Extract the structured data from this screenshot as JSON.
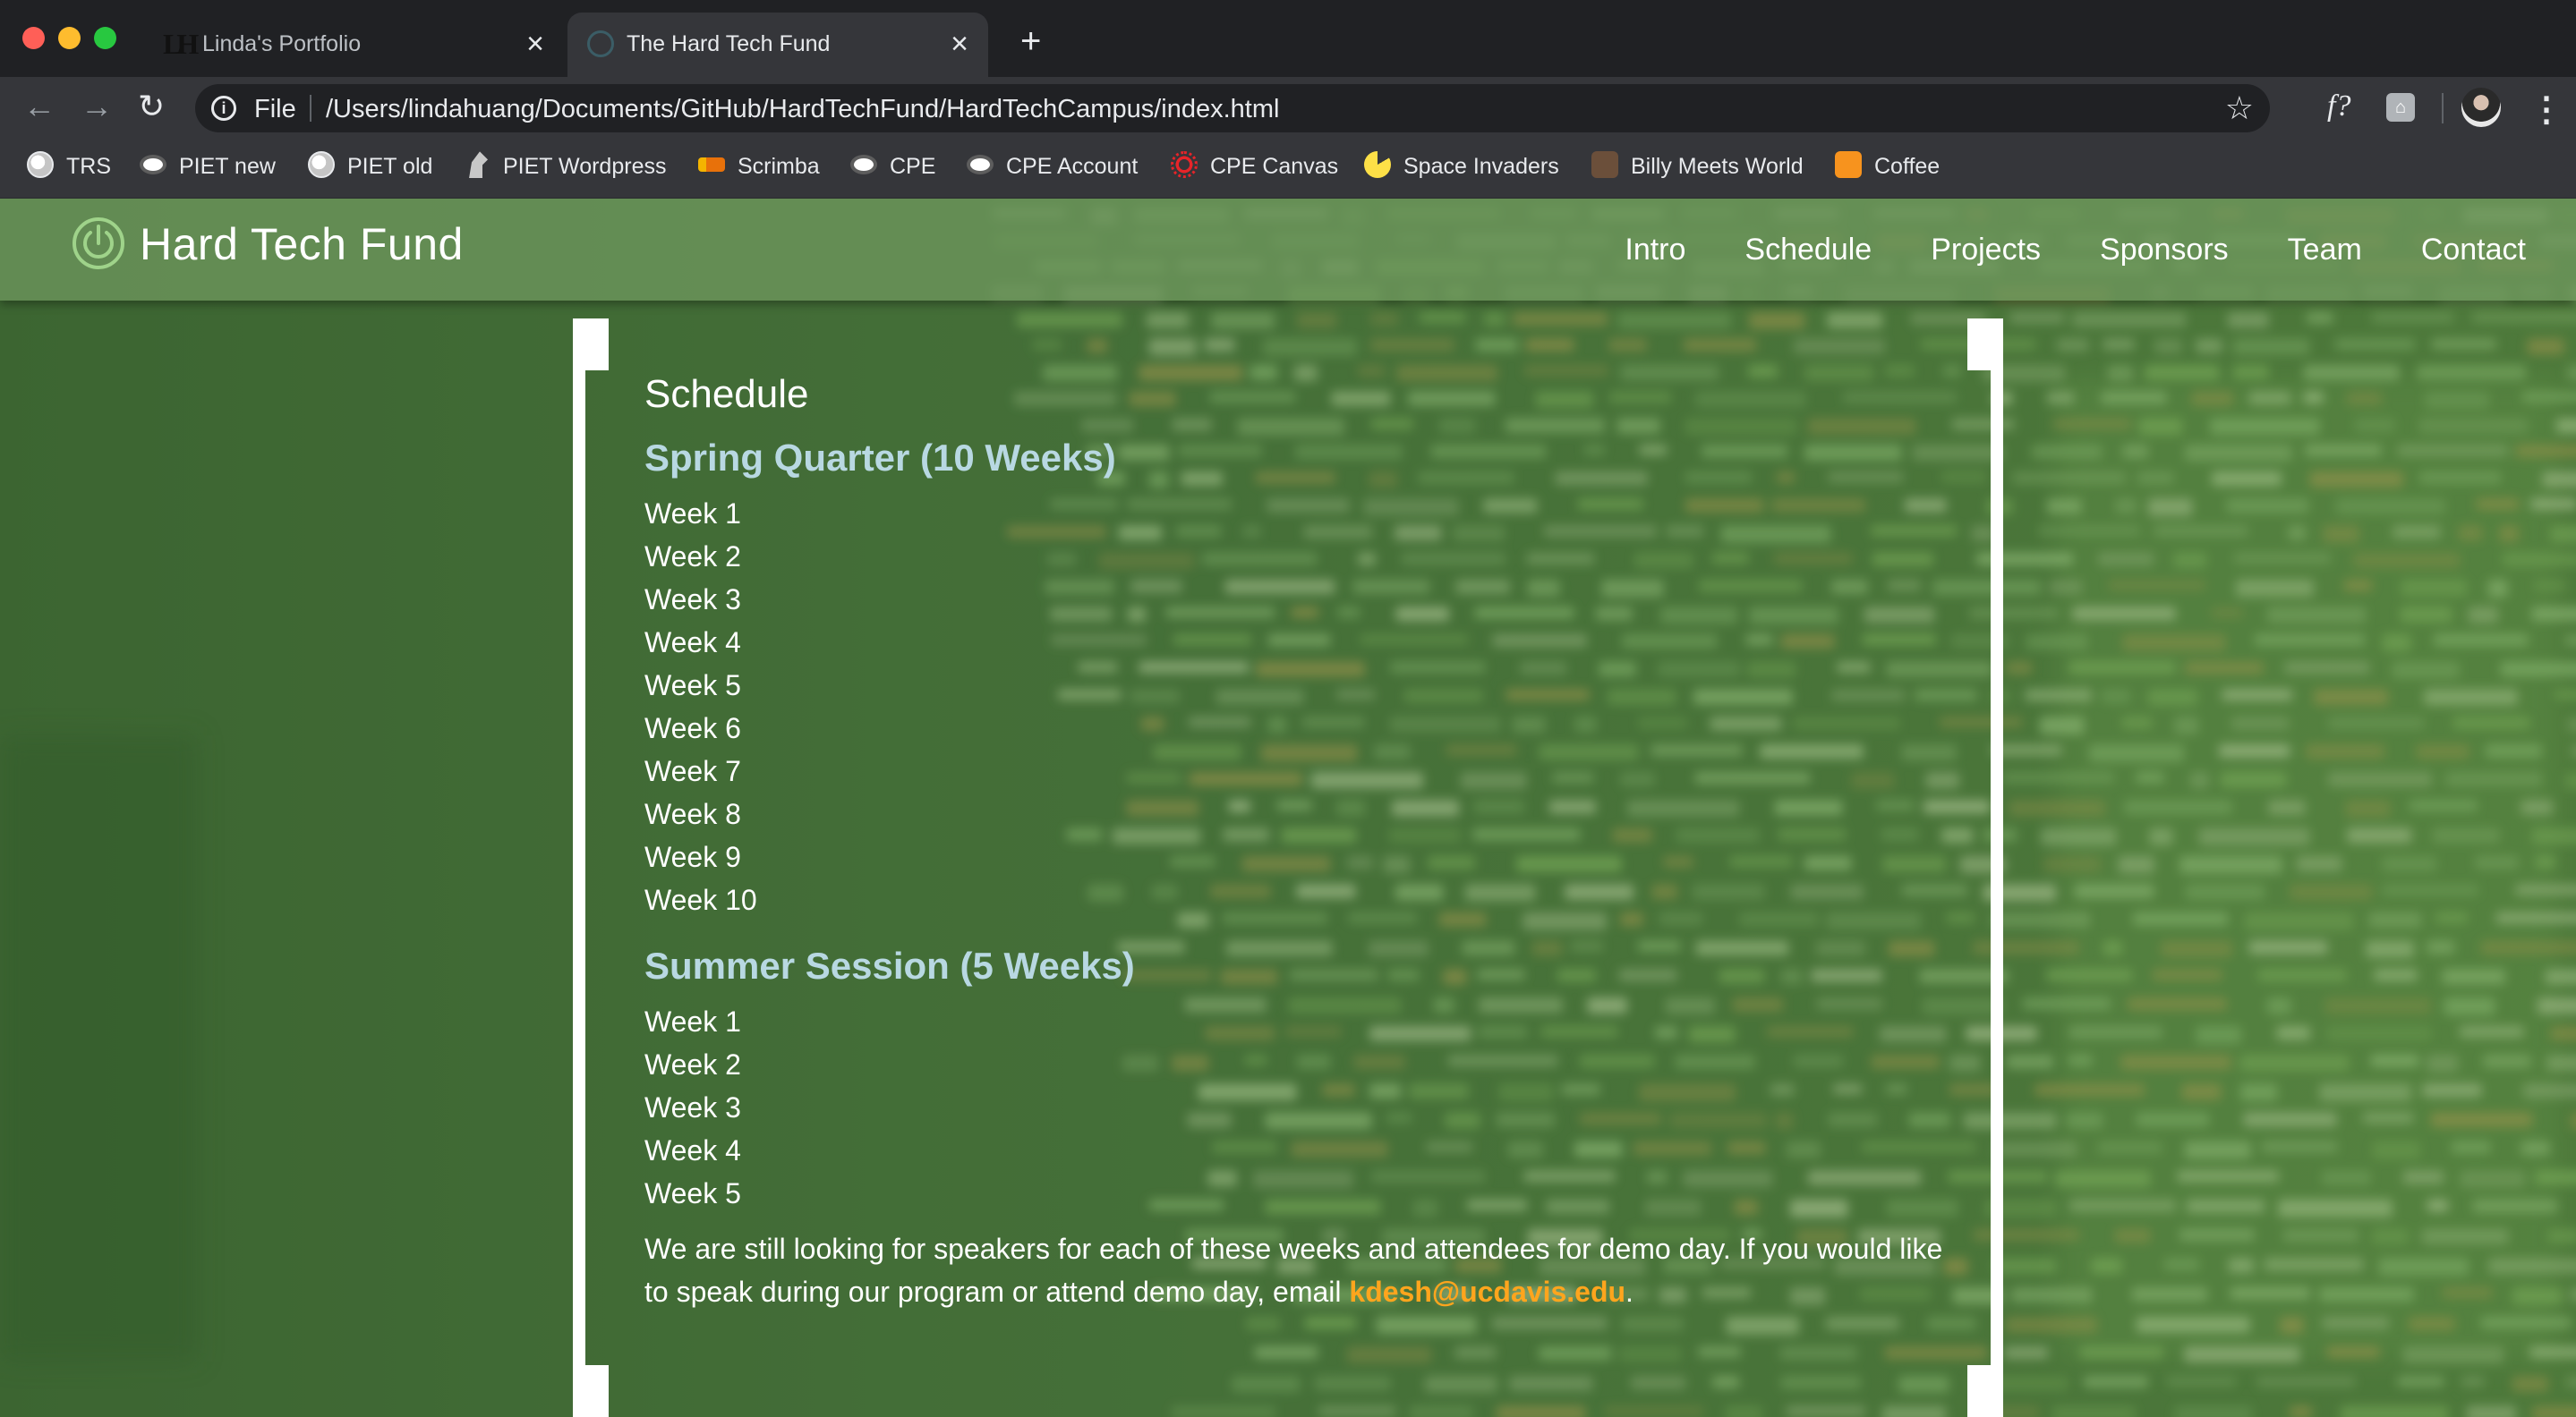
{
  "browser": {
    "tabs": [
      {
        "title": "Linda's Portfolio",
        "favicon": "lh-logo-icon"
      },
      {
        "title": "The Hard Tech Fund",
        "favicon": "hard-tech-fund-icon"
      }
    ],
    "new_tab": "+",
    "omnibox": {
      "scheme": "File",
      "url": "/Users/lindahuang/Documents/GitHub/HardTechFund/HardTechCampus/index.html"
    },
    "extension_label": "f?",
    "bookmarks": [
      {
        "label": "TRS",
        "icon": "globe-icon"
      },
      {
        "label": "PIET new",
        "icon": "piet-icon"
      },
      {
        "label": "PIET old",
        "icon": "globe-icon"
      },
      {
        "label": "PIET Wordpress",
        "icon": "horse-icon"
      },
      {
        "label": "Scrimba",
        "icon": "scrimba-icon"
      },
      {
        "label": "CPE",
        "icon": "piet-icon"
      },
      {
        "label": "CPE Account",
        "icon": "piet-icon"
      },
      {
        "label": "CPE Canvas",
        "icon": "canvas-icon"
      },
      {
        "label": "Space Invaders",
        "icon": "pacman-icon"
      },
      {
        "label": "Billy Meets World",
        "icon": "billy-icon"
      },
      {
        "label": "Coffee",
        "icon": "coffee-icon"
      }
    ]
  },
  "site": {
    "brand": "Hard Tech Fund",
    "nav": [
      "Intro",
      "Schedule",
      "Projects",
      "Sponsors",
      "Team",
      "Contact"
    ],
    "accent_color": "#ffa51d",
    "heading_color": "#b8d8e2"
  },
  "schedule": {
    "title": "Schedule",
    "spring": {
      "title": "Spring Quarter (10 Weeks)",
      "weeks": [
        "Week 1",
        "Week 2",
        "Week 3",
        "Week 4",
        "Week 5",
        "Week 6",
        "Week 7",
        "Week 8",
        "Week 9",
        "Week 10"
      ]
    },
    "summer": {
      "title": "Summer Session (5 Weeks)",
      "weeks": [
        "Week 1",
        "Week 2",
        "Week 3",
        "Week 4",
        "Week 5"
      ]
    },
    "note_text": "We are still looking for speakers for each of these weeks and attendees for demo day. If you would like to speak during our program or attend demo day, email ",
    "email": "kdesh@ucdavis.edu",
    "note_end": "."
  }
}
